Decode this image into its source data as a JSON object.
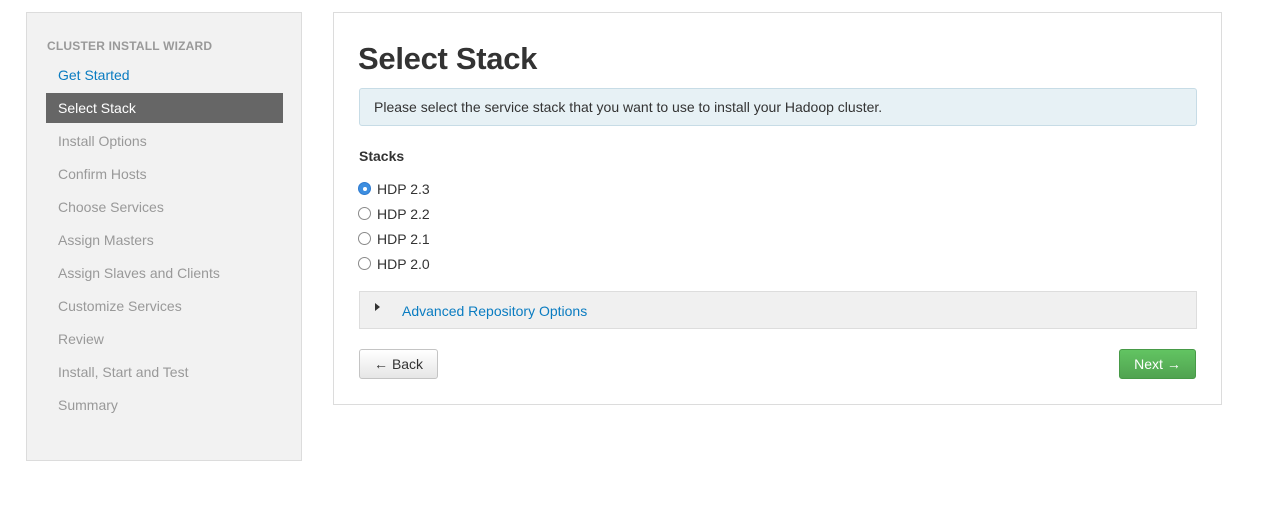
{
  "sidebar": {
    "heading": "CLUSTER INSTALL WIZARD",
    "steps": [
      {
        "label": "Get Started",
        "state": "done"
      },
      {
        "label": "Select Stack",
        "state": "active"
      },
      {
        "label": "Install Options",
        "state": "pending"
      },
      {
        "label": "Confirm Hosts",
        "state": "pending"
      },
      {
        "label": "Choose Services",
        "state": "pending"
      },
      {
        "label": "Assign Masters",
        "state": "pending"
      },
      {
        "label": "Assign Slaves and Clients",
        "state": "pending"
      },
      {
        "label": "Customize Services",
        "state": "pending"
      },
      {
        "label": "Review",
        "state": "pending"
      },
      {
        "label": "Install, Start and Test",
        "state": "pending"
      },
      {
        "label": "Summary",
        "state": "pending"
      }
    ]
  },
  "main": {
    "title": "Select Stack",
    "info_message": "Please select the service stack that you want to use to install your Hadoop cluster.",
    "stacks_label": "Stacks",
    "stacks": [
      {
        "label": "HDP 2.3",
        "selected": true
      },
      {
        "label": "HDP 2.2",
        "selected": false
      },
      {
        "label": "HDP 2.1",
        "selected": false
      },
      {
        "label": "HDP 2.0",
        "selected": false
      }
    ],
    "advanced_options_label": "Advanced Repository Options",
    "back_label": "Back",
    "back_arrow": "←",
    "next_label": "Next",
    "next_arrow": "→"
  },
  "colors": {
    "link": "#0a7cc1",
    "active_step_bg": "#666666",
    "next_button": "#5bb75b",
    "radio_selected": "#3d8ee0",
    "info_bg": "#e7f1f5"
  }
}
